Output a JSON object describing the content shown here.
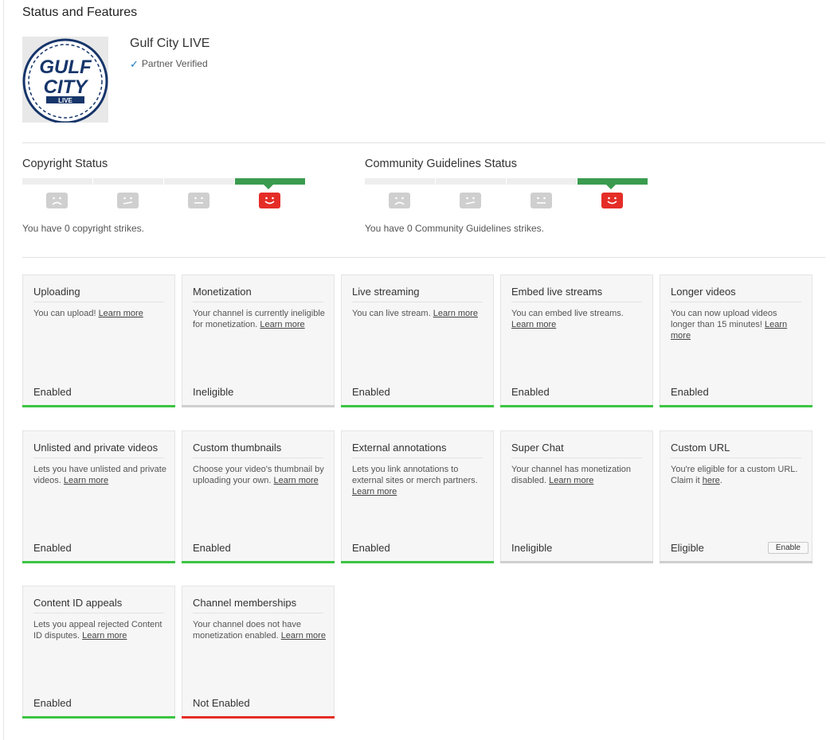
{
  "page": {
    "title": "Status and Features"
  },
  "channel": {
    "name": "Gulf City LIVE",
    "verified_label": "Partner Verified",
    "logo": {
      "line1": "GULF",
      "line2": "CITY",
      "line3": "LIVE",
      "color": "#16356a"
    }
  },
  "copyright": {
    "title": "Copyright Status",
    "strikes_text": "You have 0 copyright strikes.",
    "active_level": 4
  },
  "community": {
    "title": "Community Guidelines Status",
    "strikes_text": "You have 0 Community Guidelines strikes.",
    "active_level": 4
  },
  "colors": {
    "enabled": "#3cc442",
    "ineligible": "#cfcfcf",
    "not_enabled": "#e52d27",
    "status_good": "#3a9b4f"
  },
  "features": [
    {
      "title": "Uploading",
      "desc": "You can upload! ",
      "link": "Learn more",
      "state": "Enabled",
      "status": "enabled"
    },
    {
      "title": "Monetization",
      "desc": "Your channel is currently ineligible for monetization. ",
      "link": "Learn more",
      "state": "Ineligible",
      "status": "ineligible"
    },
    {
      "title": "Live streaming",
      "desc": "You can live stream. ",
      "link": "Learn more",
      "state": "Enabled",
      "status": "enabled"
    },
    {
      "title": "Embed live streams",
      "desc": "You can embed live streams. ",
      "link": "Learn more",
      "state": "Enabled",
      "status": "enabled"
    },
    {
      "title": "Longer videos",
      "desc": "You can now upload videos longer than 15 minutes! ",
      "link": "Learn more",
      "state": "Enabled",
      "status": "enabled"
    },
    {
      "title": "Unlisted and private videos",
      "desc": "Lets you have unlisted and private videos. ",
      "link": "Learn more",
      "state": "Enabled",
      "status": "enabled"
    },
    {
      "title": "Custom thumbnails",
      "desc": "Choose your video's thumbnail by uploading your own. ",
      "link": "Learn more",
      "state": "Enabled",
      "status": "enabled"
    },
    {
      "title": "External annotations",
      "desc": "Lets you link annotations to external sites or merch partners. ",
      "link": "Learn more",
      "state": "Enabled",
      "status": "enabled"
    },
    {
      "title": "Super Chat",
      "desc": "Your channel has monetization disabled. ",
      "link": "Learn more",
      "state": "Ineligible",
      "status": "ineligible"
    },
    {
      "title": "Custom URL",
      "desc": "You're eligible for a custom URL. Claim it ",
      "link": "here",
      "desc_after": ".",
      "state": "Eligible",
      "status": "ineligible",
      "button": "Enable"
    },
    {
      "title": "Content ID appeals",
      "desc": "Lets you appeal rejected Content ID disputes. ",
      "link": "Learn more",
      "state": "Enabled",
      "status": "enabled"
    },
    {
      "title": "Channel memberships",
      "desc": "Your channel does not have monetization enabled. ",
      "link": "Learn more",
      "state": "Not Enabled",
      "status": "not_enabled"
    }
  ]
}
